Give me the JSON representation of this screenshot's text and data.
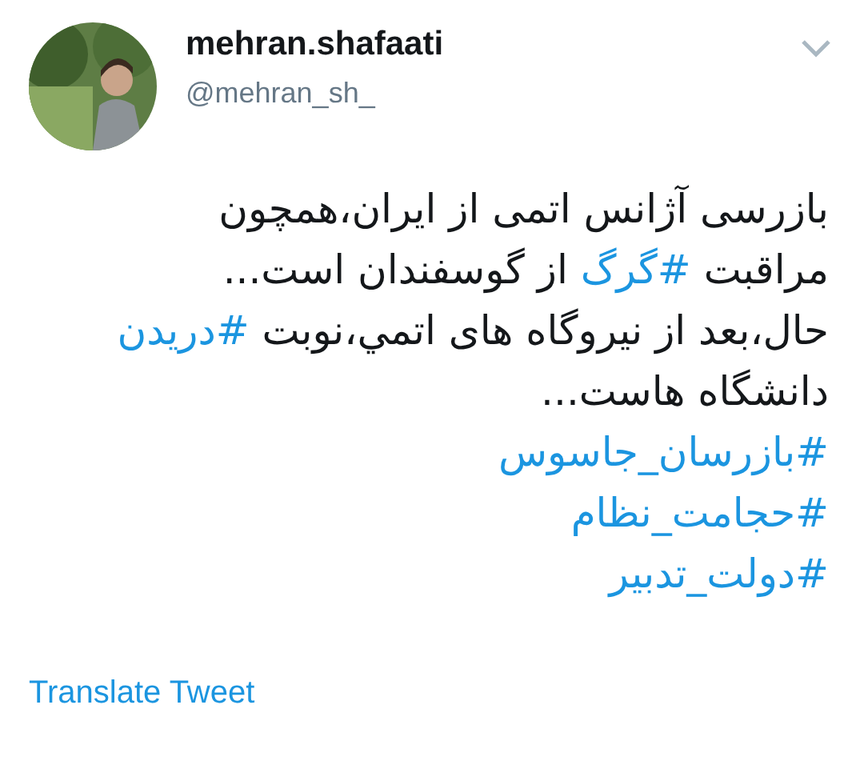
{
  "author": {
    "name": "mehran.shafaati",
    "handle": "@mehran_sh_"
  },
  "body": [
    {
      "segments": [
        {
          "kind": "text",
          "text": "بازرسی آژانس اتمی از ایران،همچون"
        }
      ]
    },
    {
      "segments": [
        {
          "kind": "text",
          "text": "مراقبت "
        },
        {
          "kind": "hashtag",
          "text": "#گرگ"
        },
        {
          "kind": "text",
          "text": " از گوسفندان است..."
        }
      ]
    },
    {
      "segments": [
        {
          "kind": "text",
          "text": "حال،بعد از نیروگاه های اتمي،نوبت "
        },
        {
          "kind": "hashtag",
          "text": "#دریدن"
        }
      ]
    },
    {
      "segments": [
        {
          "kind": "text",
          "text": "دانشگاه هاست..."
        }
      ]
    },
    {
      "segments": [
        {
          "kind": "hashtag",
          "text": "#بازرسان_جاسوس"
        }
      ]
    },
    {
      "segments": [
        {
          "kind": "hashtag",
          "text": "#حجامت_نظام"
        }
      ]
    },
    {
      "segments": [
        {
          "kind": "hashtag",
          "text": "#دولت_تدبیر"
        }
      ]
    }
  ],
  "translate_link": "Translate Tweet"
}
